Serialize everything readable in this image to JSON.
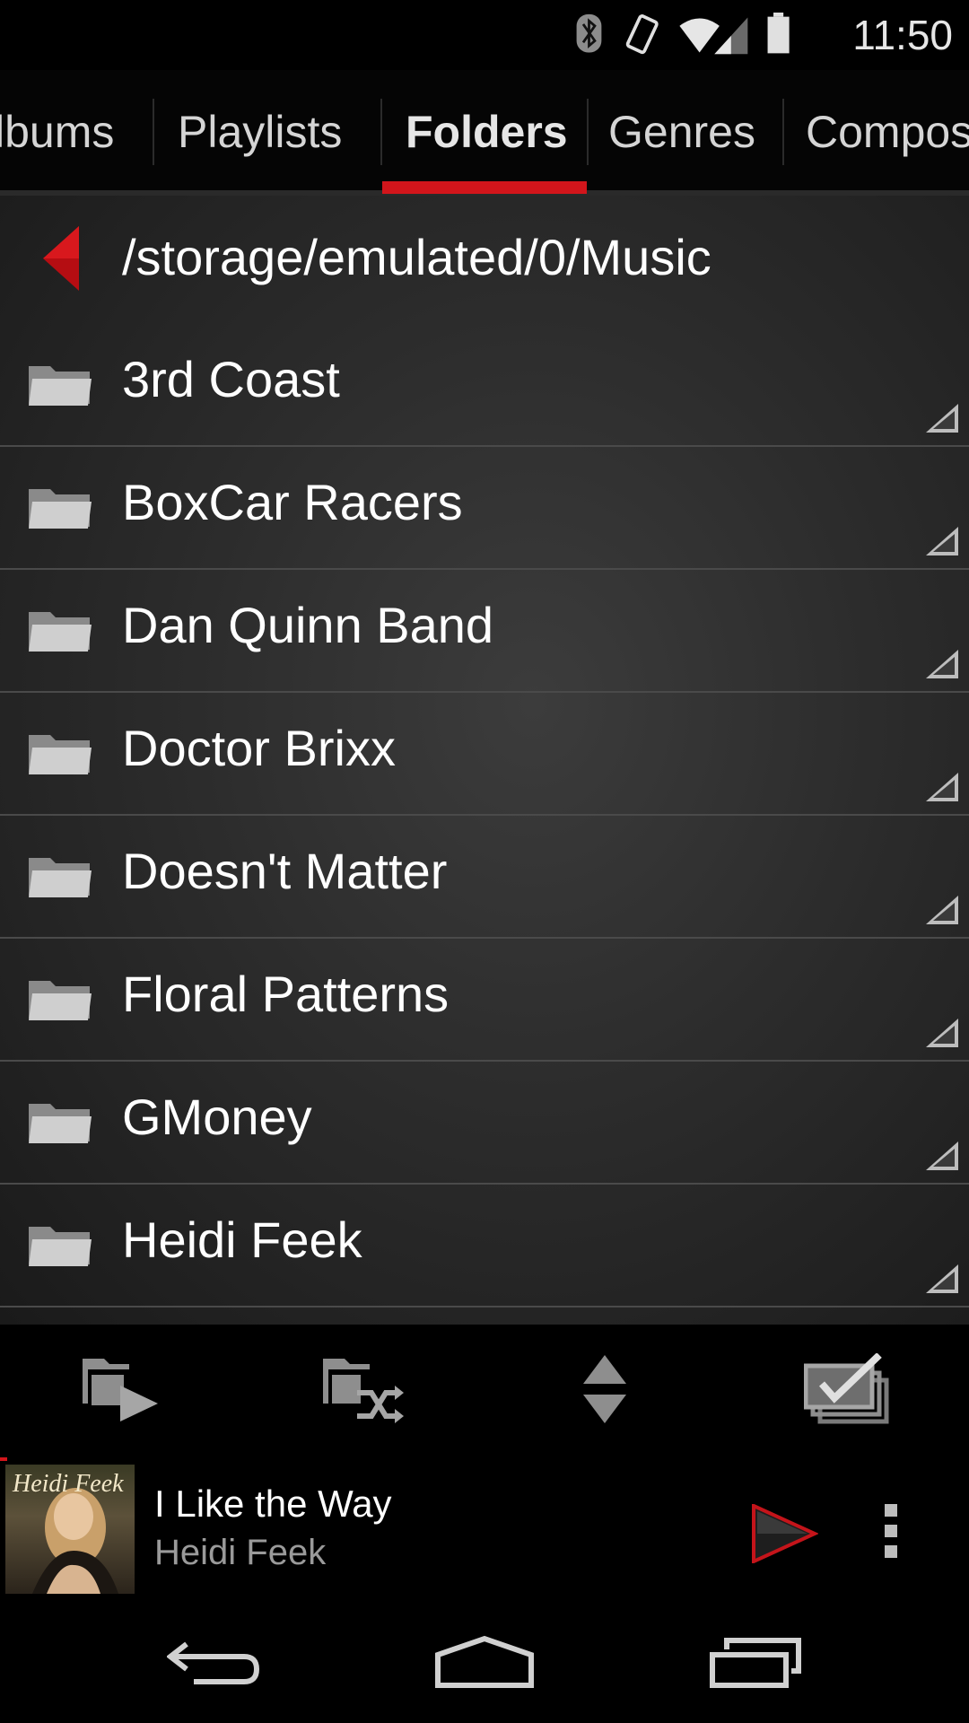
{
  "status_bar": {
    "time": "11:50",
    "icons": [
      "bluetooth-icon",
      "vibrate-icon",
      "wifi-icon",
      "signal-icon",
      "battery-icon"
    ]
  },
  "tabs": [
    {
      "label": "lbums",
      "active": false
    },
    {
      "label": "Playlists",
      "active": false
    },
    {
      "label": "Folders",
      "active": true
    },
    {
      "label": "Genres",
      "active": false
    },
    {
      "label": "Compos",
      "active": false
    }
  ],
  "path": "/storage/emulated/0/Music",
  "folders": [
    "3rd Coast",
    "BoxCar Racers",
    "Dan Quinn Band",
    "Doctor Brixx",
    "Doesn't Matter",
    "Floral Patterns",
    "GMoney",
    "Heidi Feek"
  ],
  "toolbar": [
    "play-folder-icon",
    "shuffle-folder-icon",
    "sort-icon",
    "multi-select-icon"
  ],
  "now_playing": {
    "title": "I Like the Way",
    "artist": "Heidi Feek",
    "album_art_text": "Heidi Feek"
  },
  "colors": {
    "accent": "#d2151b",
    "background": "#2e2e2e",
    "text": "#ffffff",
    "secondary_text": "#9a9a9a"
  }
}
